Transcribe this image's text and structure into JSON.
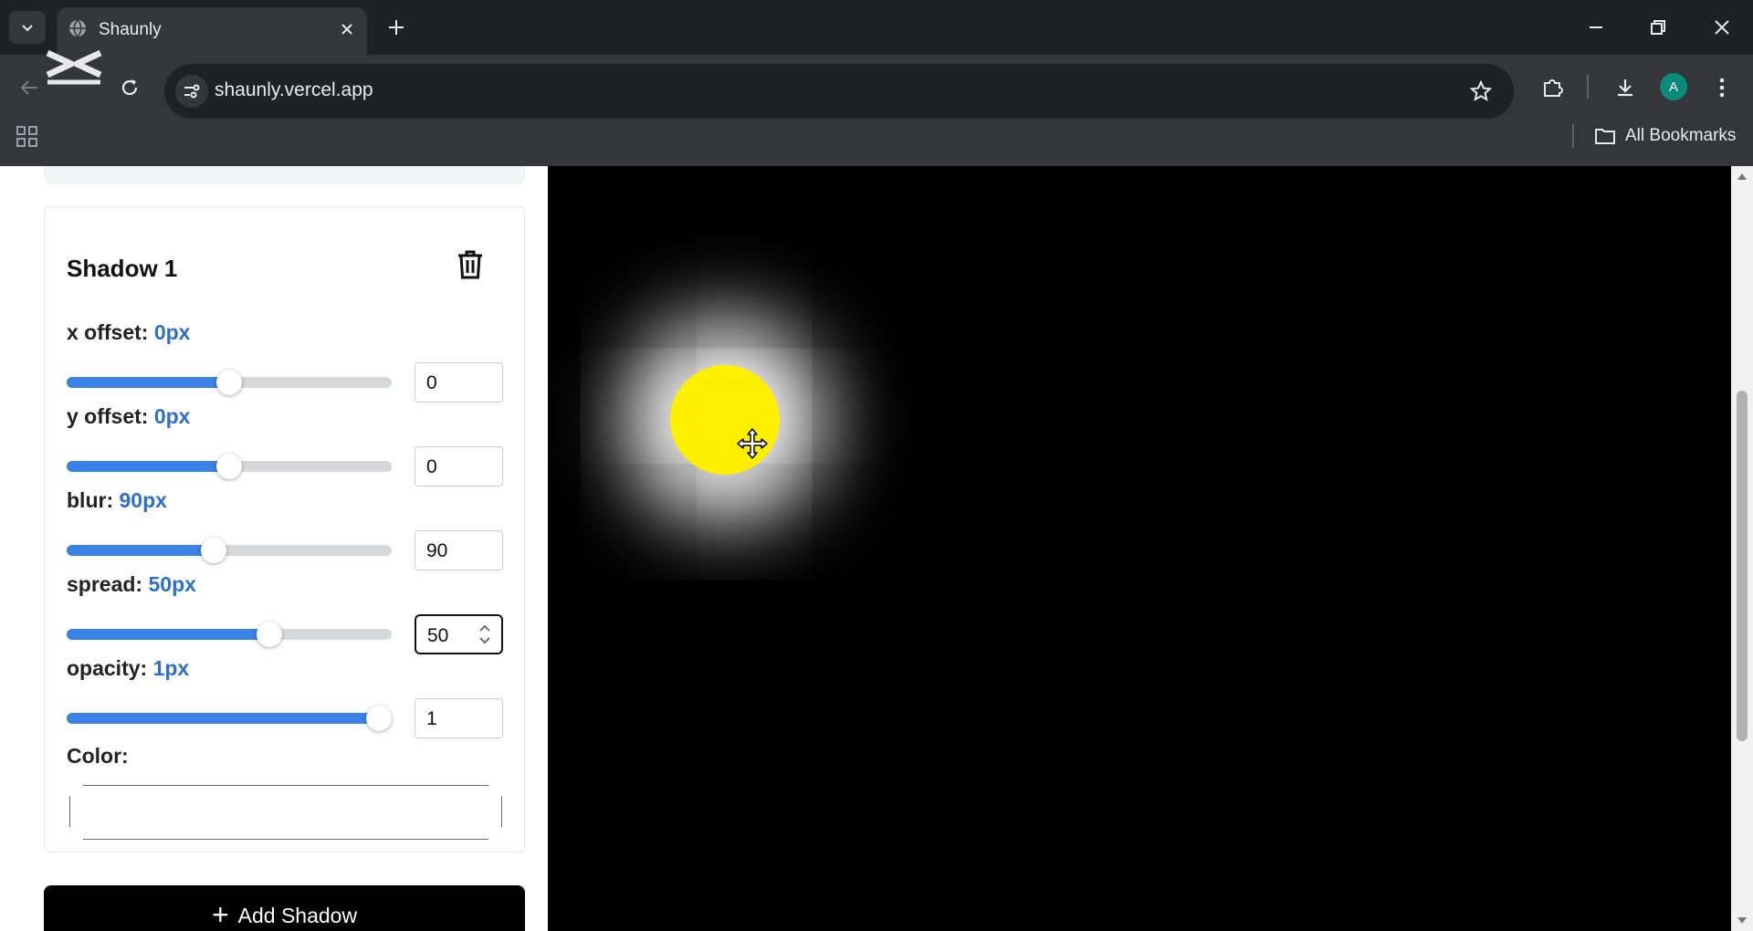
{
  "browser": {
    "tab_title": "Shaunly",
    "url": "shaunly.vercel.app",
    "profile_initial": "A",
    "bookmarks_label": "All Bookmarks"
  },
  "shadow_card": {
    "title": "Shadow 1",
    "controls": [
      {
        "name": "x offset",
        "label": "x offset: ",
        "display": "0px",
        "value": "0",
        "fraction": 0.5
      },
      {
        "name": "y offset",
        "label": "y offset: ",
        "display": "0px",
        "value": "0",
        "fraction": 0.5
      },
      {
        "name": "blur",
        "label": "blur: ",
        "display": "90px",
        "value": "90",
        "fraction": 0.45
      },
      {
        "name": "spread",
        "label": "spread: ",
        "display": "50px",
        "value": "50",
        "fraction": 0.63
      },
      {
        "name": "opacity",
        "label": "opacity: ",
        "display": "1px",
        "value": "1",
        "fraction": 1.0
      }
    ],
    "color_label": "Color:"
  },
  "add_button_label": "Add Shadow",
  "preview": {
    "element_color": "#fff000",
    "shadow_color": "#ffffff",
    "background": "#000000"
  },
  "icons": [
    "tab-list-icon",
    "globe-icon",
    "close-icon",
    "plus-icon",
    "minimize-icon",
    "restore-icon",
    "back-icon",
    "reload-icon",
    "site-info-icon",
    "star-icon",
    "extensions-icon",
    "download-icon",
    "menu-icon",
    "apps-icon",
    "folder-icon",
    "trash-icon",
    "move-cursor-icon"
  ]
}
